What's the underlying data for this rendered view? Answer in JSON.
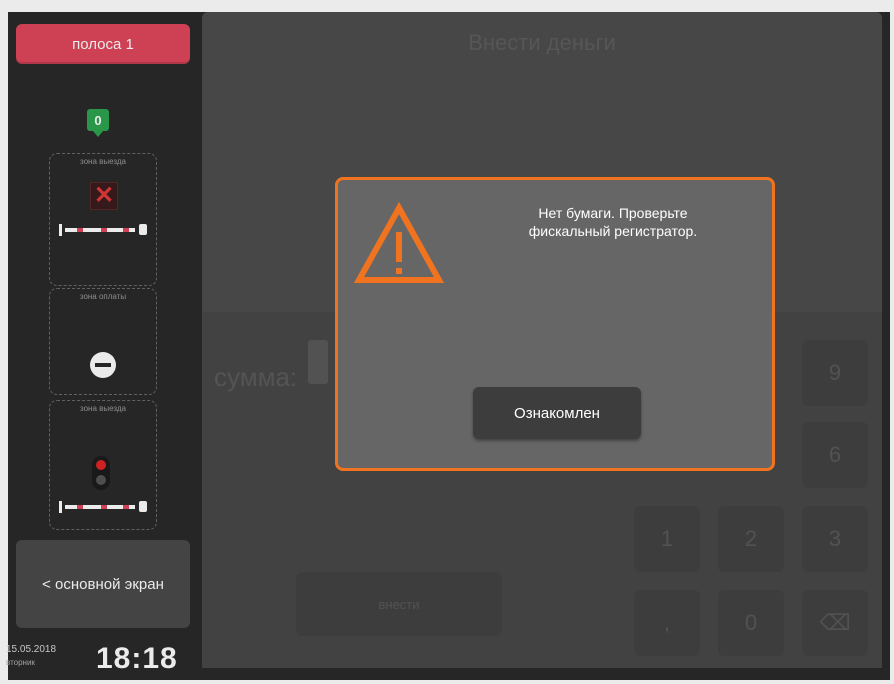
{
  "sidebar": {
    "lane_button": "полоса 1",
    "marker_value": "0",
    "zones": [
      {
        "label": "зона выезда",
        "state": "closed-x"
      },
      {
        "label": "зона оплаты",
        "state": "no-entry"
      },
      {
        "label": "зона выезда",
        "state": "red-light"
      }
    ],
    "main_screen_button": "< основной экран",
    "date": "15.05.2018",
    "weekday": "вторник",
    "time": "18:18"
  },
  "main": {
    "title": "Внести деньги",
    "sum_label": "сумма:",
    "submit_button": "внести",
    "keypad": {
      "row1": [
        "9"
      ],
      "row2": [
        "6"
      ],
      "row3": [
        "1",
        "2",
        "3"
      ],
      "row4": [
        ",",
        "0",
        "⌫"
      ]
    }
  },
  "modal": {
    "message_line1": "Нет бумаги. Проверьте",
    "message_line2": "фискальный регистратор.",
    "ack_button": "Ознакомлен",
    "accent_color": "#f07420"
  },
  "colors": {
    "lane_active": "#e0475c",
    "marker_green": "#2ea44f"
  }
}
